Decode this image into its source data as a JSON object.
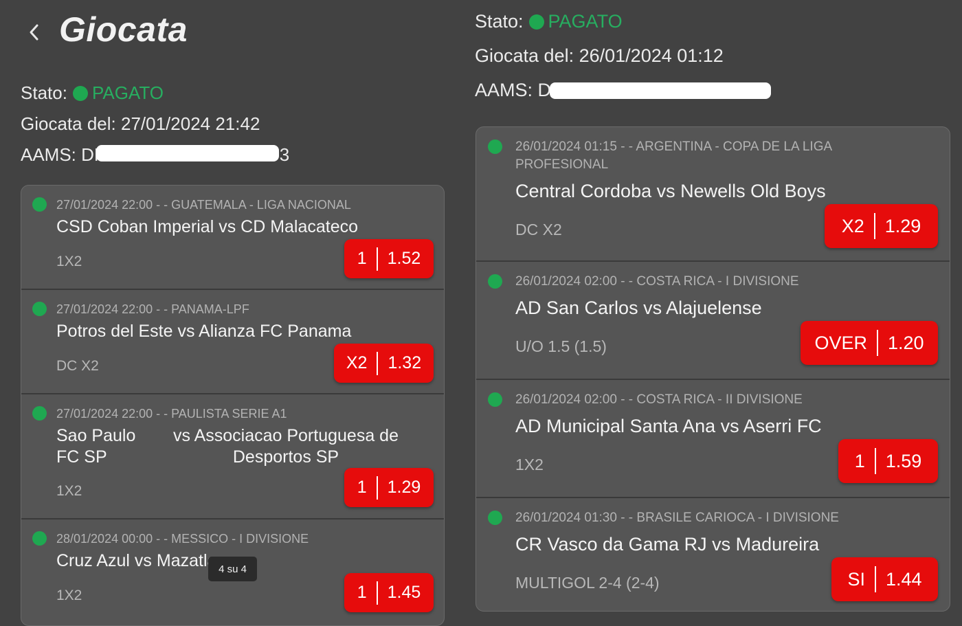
{
  "header": {
    "title": "Giocata"
  },
  "left": {
    "status_label": "Stato:",
    "status_value": "PAGATO",
    "date_label": "Giocata del:",
    "date_value": "27/01/2024 21:42",
    "aams_label": "AAMS:",
    "aams_prefix": "DF",
    "aams_suffix": "103",
    "bets": [
      {
        "meta": "27/01/2024 22:00  -    - GUATEMALA - LIGA NACIONAL",
        "match": "CSD Coban Imperial vs CD Malacateco",
        "market": "1X2",
        "pick": "1",
        "odd": "1.52"
      },
      {
        "meta": "27/01/2024 22:00  -    - PANAMA-LPF",
        "match": "Potros del Este vs Alianza FC Panama",
        "market": "DC X2",
        "pick": "X2",
        "odd": "1.32"
      },
      {
        "meta": "27/01/2024 22:00  -    - PAULISTA SERIE A1",
        "home": "Sao Paulo FC SP",
        "away": "vs Associacao Portuguesa de Desportos SP",
        "market": "1X2",
        "pick": "1",
        "odd": "1.29"
      },
      {
        "meta": "28/01/2024 00:00  -    - MESSICO - I DIVISIONE",
        "match": "Cruz Azul vs Mazatlan",
        "market": "1X2",
        "pick": "1",
        "odd": "1.45"
      }
    ],
    "page_indicator": "4 su 4"
  },
  "right": {
    "status_label": "Stato:",
    "status_value": "PAGATO",
    "date_label": "Giocata del:",
    "date_value": "26/01/2024 01:12",
    "aams_label": "AAMS:",
    "aams_prefix": "D",
    "bets": [
      {
        "meta": "26/01/2024 01:15  -    - ARGENTINA - COPA DE LA LIGA PROFESIONAL",
        "match": "Central Cordoba vs Newells Old Boys",
        "market": "DC X2",
        "pick": "X2",
        "odd": "1.29"
      },
      {
        "meta": "26/01/2024 02:00  -    - COSTA RICA - I DIVISIONE",
        "match": "AD San Carlos vs Alajuelense",
        "market": "U/O 1.5 (1.5)",
        "pick": "OVER",
        "odd": "1.20"
      },
      {
        "meta": "26/01/2024 02:00  -    - COSTA RICA - II DIVISIONE",
        "match": "AD Municipal Santa Ana vs Aserri FC",
        "market": "1X2",
        "pick": "1",
        "odd": "1.59"
      },
      {
        "meta": "26/01/2024 01:30  -    - BRASILE CARIOCA - I DIVISIONE",
        "match": "CR Vasco da Gama RJ vs Madureira",
        "market": "MULTIGOL 2-4 (2-4)",
        "pick": "SI",
        "odd": "1.44"
      }
    ]
  },
  "colors": {
    "background": "#424242",
    "card": "#555555",
    "accent_red": "#e60c0c",
    "status_green": "#1fa851"
  }
}
